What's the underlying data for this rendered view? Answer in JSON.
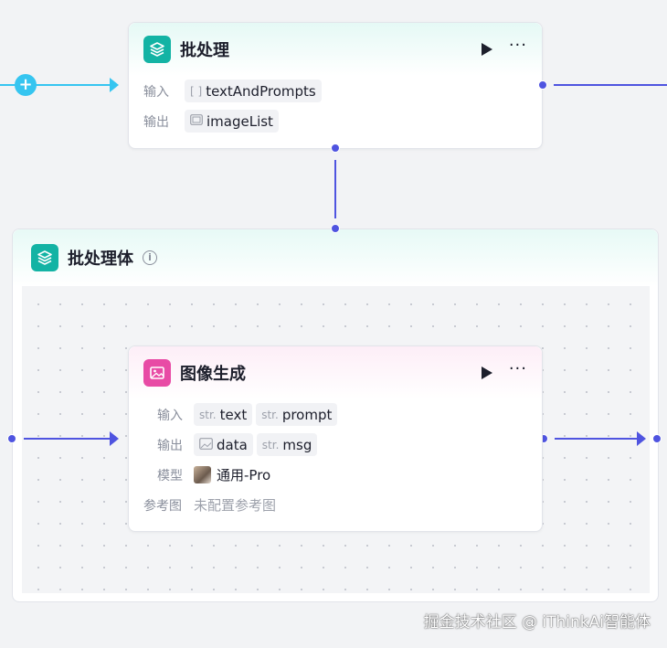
{
  "batch_node": {
    "title": "批处理",
    "input_label": "输入",
    "input_value": "textAndPrompts",
    "input_icon": "array-icon",
    "output_label": "输出",
    "output_value": "imageList",
    "output_icon": "image-list-icon"
  },
  "loop_body": {
    "title": "批处理体",
    "info_icon": "info-icon"
  },
  "image_node": {
    "title": "图像生成",
    "input_label": "输入",
    "input_tags": [
      {
        "type": "str.",
        "name": "text"
      },
      {
        "type": "str.",
        "name": "prompt"
      }
    ],
    "output_label": "输出",
    "output_image_tag": "data",
    "output_str_type": "str.",
    "output_str_tag": "msg",
    "model_label": "模型",
    "model_value": "通用-Pro",
    "ref_label": "参考图",
    "ref_value": "未配置参考图"
  },
  "colors": {
    "edge": "#4f54e0",
    "edge_in": "#36c5f0",
    "batch_icon": "#13b3a4",
    "image_icon": "#e84ba5"
  },
  "watermark": "掘金技术社区 @ iThinkAi智能体"
}
